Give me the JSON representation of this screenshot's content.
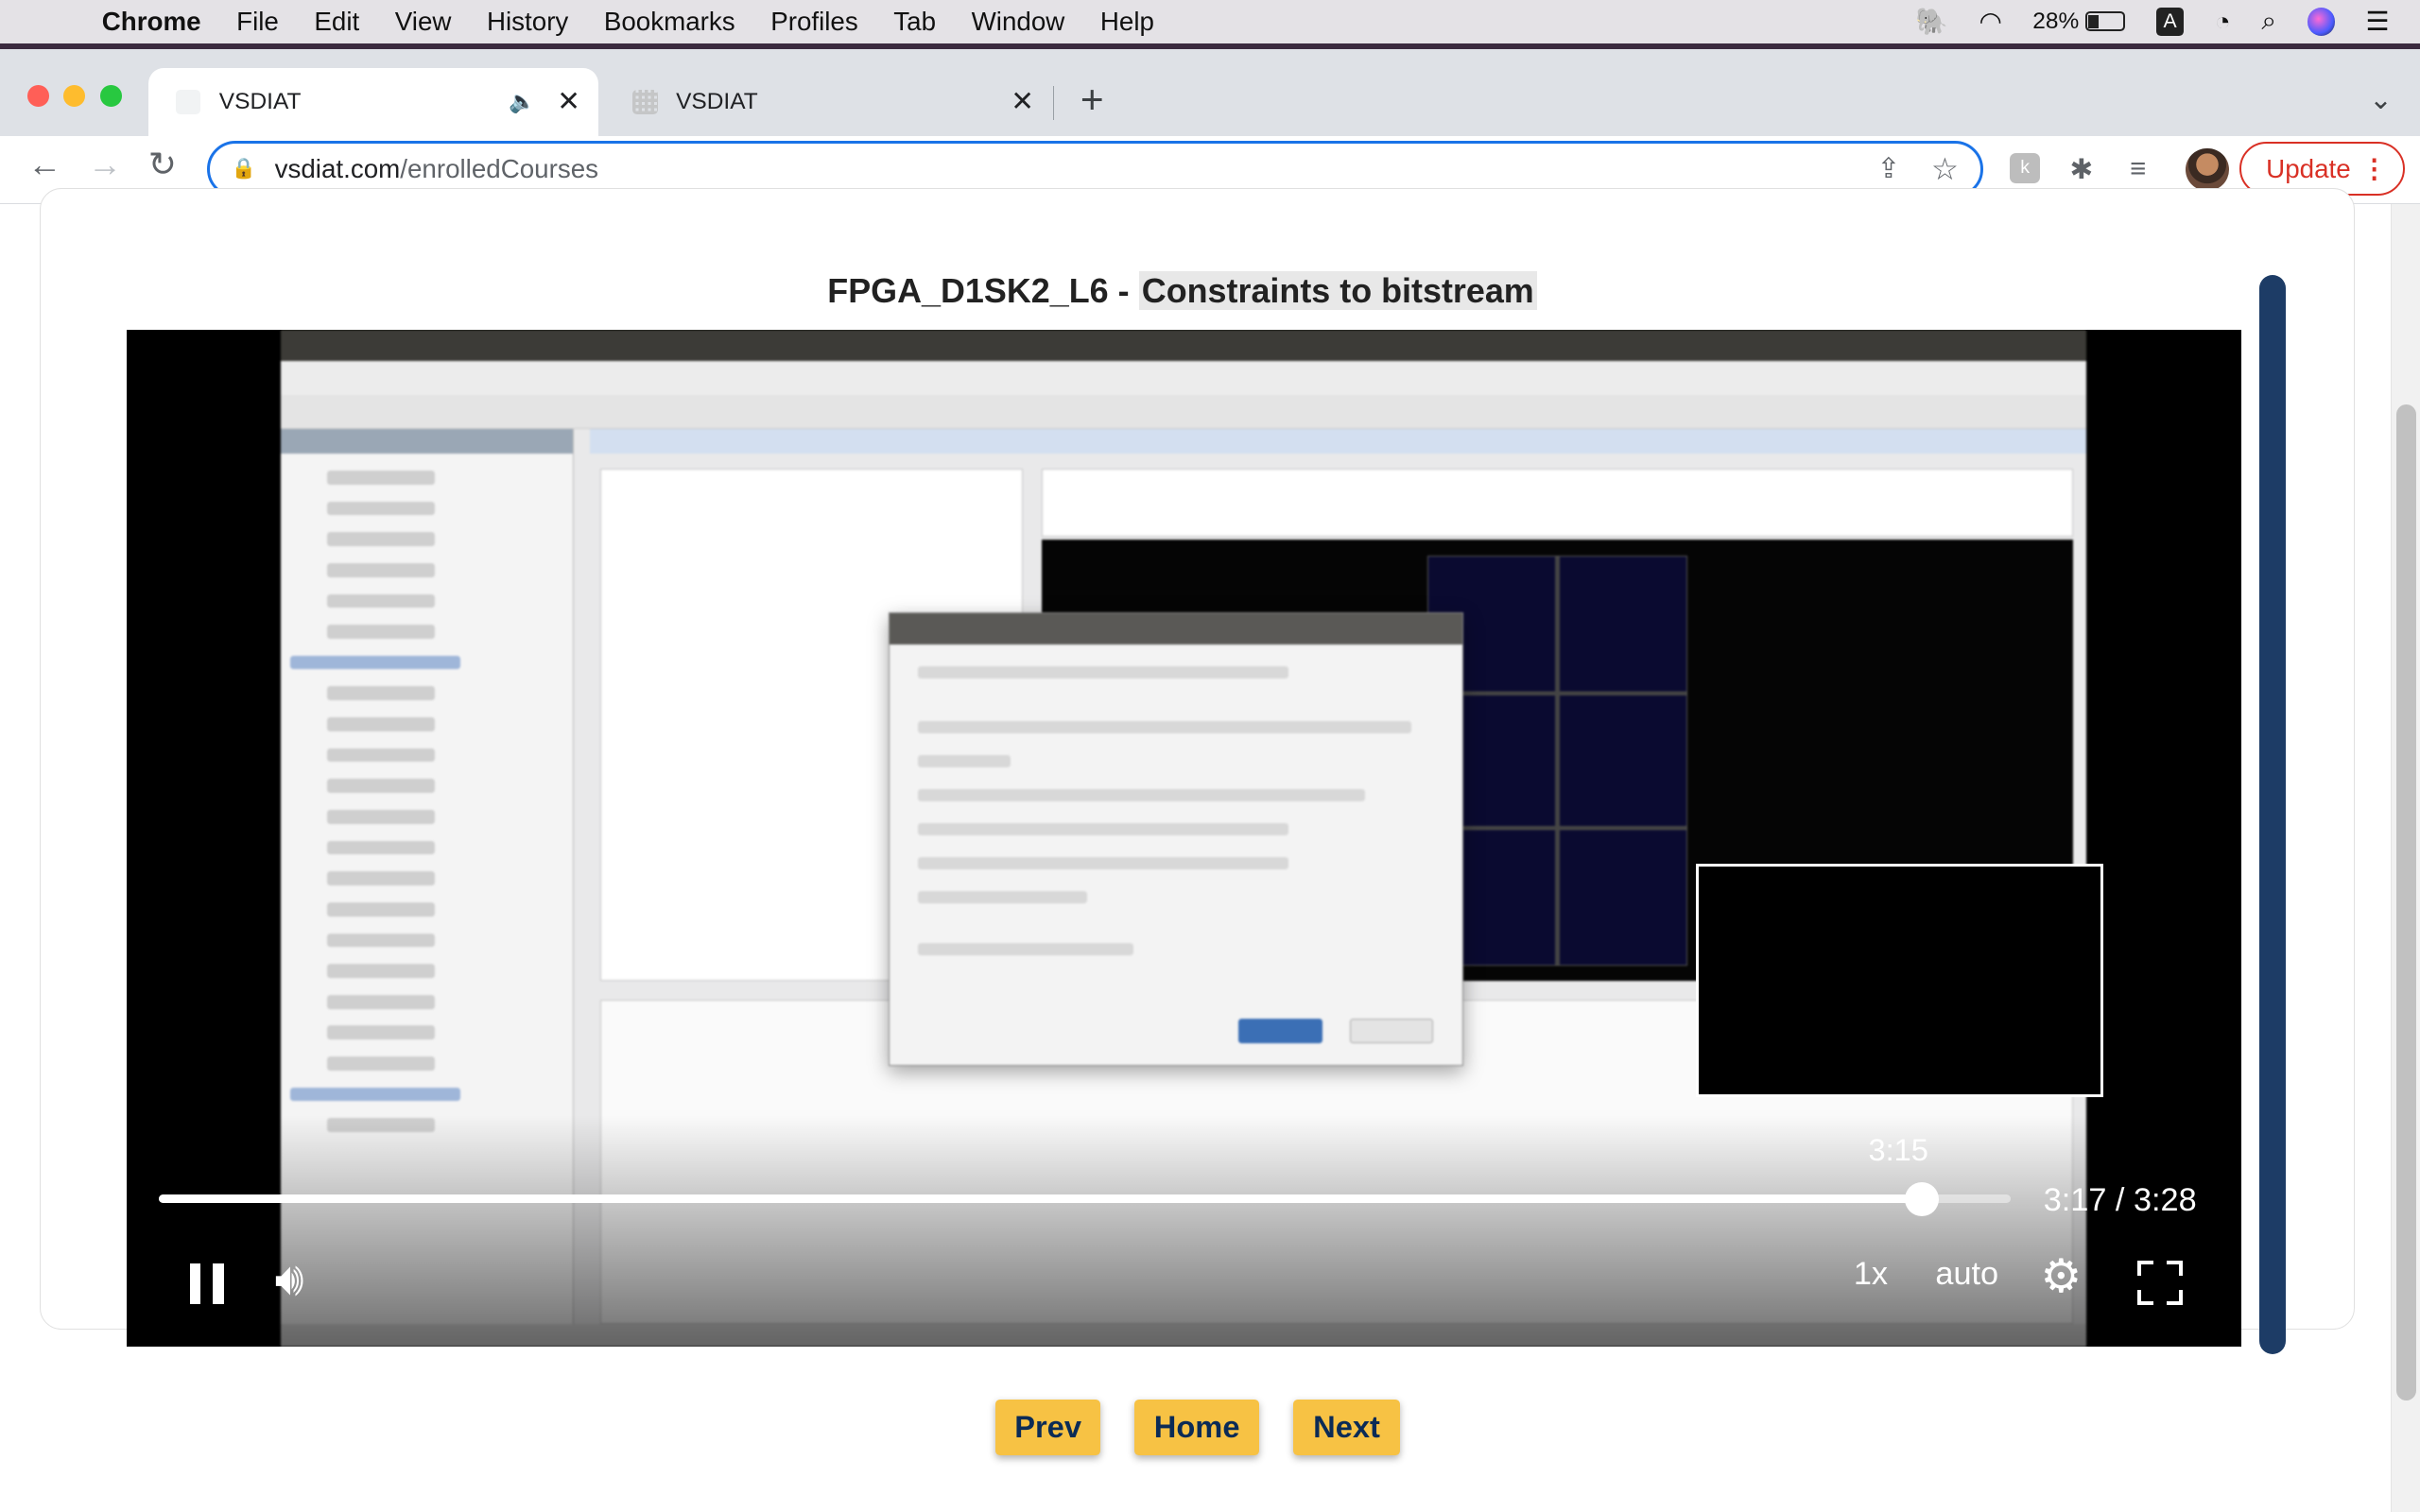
{
  "menubar": {
    "app": "Chrome",
    "items": [
      "File",
      "Edit",
      "View",
      "History",
      "Bookmarks",
      "Profiles",
      "Tab",
      "Window",
      "Help"
    ],
    "battery": "28%",
    "status_icons": [
      "evernote-icon",
      "wifi-icon",
      "battery-icon",
      "keyboard-input-icon",
      "grammarly-icon",
      "spotlight-search-icon",
      "siri-icon",
      "control-center-icon"
    ],
    "input_letter": "A"
  },
  "tabs": [
    {
      "title": "VSDIAT",
      "active": true,
      "audio": true
    },
    {
      "title": "VSDIAT",
      "active": false,
      "audio": false
    }
  ],
  "toolbar": {
    "url_host": "vsdiat.com",
    "url_path": "/enrolledCourses",
    "update_label": "Update"
  },
  "lesson": {
    "title_prefix": "FPGA_D1SK2_L6 - ",
    "title_highlight": "Constraints to bitstream"
  },
  "player": {
    "hover_time": "3:15",
    "current_time": "3:17",
    "duration": "3:28",
    "time_display": "3:17 / 3:28",
    "progress_fraction": 0.952,
    "speed": "1x",
    "quality": "auto"
  },
  "nav_buttons": {
    "prev": "Prev",
    "home": "Home",
    "next": "Next"
  },
  "colors": {
    "accent_blue": "#1a73e8",
    "update_red": "#d93025",
    "nav_button_bg": "#f7c244",
    "nav_button_text": "#0b2b56",
    "scrollbar_navy": "#1d3c66"
  }
}
